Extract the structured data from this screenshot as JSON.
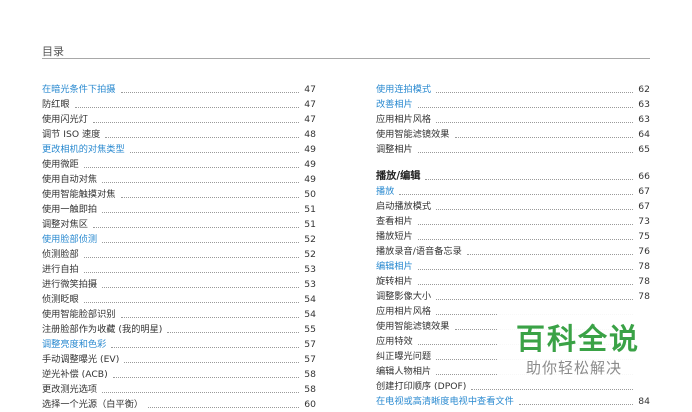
{
  "header": {
    "title": "目录"
  },
  "toc": {
    "left": [
      {
        "label": "在暗光条件下拍摄",
        "page": "47",
        "style": "blue"
      },
      {
        "label": "防红眼",
        "page": "47"
      },
      {
        "label": "使用闪光灯",
        "page": "47"
      },
      {
        "label": "调节 ISO 速度",
        "page": "48"
      },
      {
        "label": "更改相机的对焦类型",
        "page": "49",
        "style": "blue"
      },
      {
        "label": "使用微距",
        "page": "49"
      },
      {
        "label": "使用自动对焦",
        "page": "49"
      },
      {
        "label": "使用智能触摸对焦",
        "page": "50"
      },
      {
        "label": "使用一触即拍",
        "page": "51"
      },
      {
        "label": "调整对焦区",
        "page": "51"
      },
      {
        "label": "使用脸部侦测",
        "page": "52",
        "style": "blue"
      },
      {
        "label": "侦测脸部",
        "page": "52"
      },
      {
        "label": "进行自拍",
        "page": "53"
      },
      {
        "label": "进行微笑拍摄",
        "page": "53"
      },
      {
        "label": "侦测眨眼",
        "page": "54"
      },
      {
        "label": "使用智能脸部识别",
        "page": "54"
      },
      {
        "label": "注册脸部作为收藏 (我的明星)",
        "page": "55"
      },
      {
        "label": "调整亮度和色彩",
        "page": "57",
        "style": "blue"
      },
      {
        "label": "手动调整曝光 (EV)",
        "page": "57"
      },
      {
        "label": "逆光补偿 (ACB)",
        "page": "58"
      },
      {
        "label": "更改测光选项",
        "page": "58"
      },
      {
        "label": "选择一个光源（白平衡）",
        "page": "60"
      }
    ],
    "right": [
      {
        "label": "使用连拍模式",
        "page": "62",
        "style": "blue"
      },
      {
        "label": "改善相片",
        "page": "63",
        "style": "blue"
      },
      {
        "label": "应用相片风格",
        "page": "63"
      },
      {
        "label": "使用智能滤镜效果",
        "page": "64"
      },
      {
        "label": "调整相片",
        "page": "65"
      },
      {
        "label": "播放/编辑",
        "page": "66",
        "style": "section"
      },
      {
        "label": "播放",
        "page": "67",
        "style": "blue"
      },
      {
        "label": "启动播放模式",
        "page": "67"
      },
      {
        "label": "查看相片",
        "page": "73"
      },
      {
        "label": "播放短片",
        "page": "75"
      },
      {
        "label": "播放录音/语音备忘录",
        "page": "76"
      },
      {
        "label": "编辑相片",
        "page": "78",
        "style": "blue"
      },
      {
        "label": "旋转相片",
        "page": "78"
      },
      {
        "label": "调整影像大小",
        "page": "78"
      },
      {
        "label": "应用相片风格",
        "page": ""
      },
      {
        "label": "使用智能滤镜效果",
        "page": ""
      },
      {
        "label": "应用特效",
        "page": ""
      },
      {
        "label": "纠正曝光问题",
        "page": ""
      },
      {
        "label": "编辑人物相片",
        "page": ""
      },
      {
        "label": "创建打印顺序 (DPOF)",
        "page": ""
      },
      {
        "label": "在电视或高清晰度电视中查看文件",
        "page": "84",
        "style": "blue"
      }
    ]
  },
  "watermark": {
    "logo": "百科全说",
    "subtitle": "助你轻松解决"
  }
}
